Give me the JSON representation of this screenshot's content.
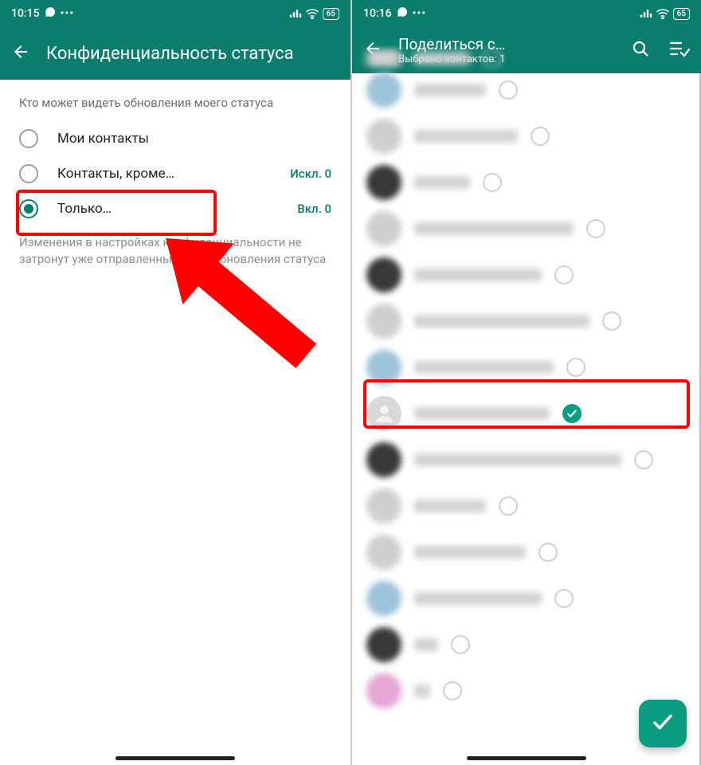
{
  "colors": {
    "brand": "#0a7d6c",
    "accent": "#0a9d82",
    "highlight": "#ff0000"
  },
  "left": {
    "status": {
      "time": "10:15",
      "battery": "65"
    },
    "appbar": {
      "title": "Конфиденциальность статуса"
    },
    "section_label": "Кто может видеть обновления моего статуса",
    "options": [
      {
        "label": "Мои контакты",
        "selected": false,
        "right": ""
      },
      {
        "label": "Контакты, кроме…",
        "selected": false,
        "right": "Искл. 0"
      },
      {
        "label": "Только…",
        "selected": true,
        "right": "Вкл. 0"
      }
    ],
    "footnote": "Изменения в настройках конфиденциальности не затронут уже отправленные вами обновления статуса"
  },
  "right": {
    "status": {
      "time": "10:16",
      "battery": "65"
    },
    "appbar": {
      "title": "Поделиться с…",
      "subtitle": "Выбрано контактов: 1"
    },
    "contacts": [
      {
        "avatar": "blueav",
        "w": "w1",
        "checked": false
      },
      {
        "avatar": "",
        "w": "w2",
        "checked": false
      },
      {
        "avatar": "dark",
        "w": "w3",
        "checked": false
      },
      {
        "avatar": "",
        "w": "w4",
        "checked": false
      },
      {
        "avatar": "dark",
        "w": "w5",
        "checked": false
      },
      {
        "avatar": "",
        "w": "w6",
        "checked": false
      },
      {
        "avatar": "blueav",
        "w": "w7",
        "checked": false
      },
      {
        "avatar": "gray",
        "w": "w8",
        "checked": true
      },
      {
        "avatar": "dark",
        "w": "w9",
        "checked": false
      },
      {
        "avatar": "",
        "w": "w10",
        "checked": false
      },
      {
        "avatar": "",
        "w": "w11",
        "checked": false
      },
      {
        "avatar": "blueav",
        "w": "w12",
        "checked": false
      },
      {
        "avatar": "dark",
        "w": "w13",
        "checked": false
      },
      {
        "avatar": "pink",
        "w": "w14",
        "checked": false
      }
    ]
  }
}
